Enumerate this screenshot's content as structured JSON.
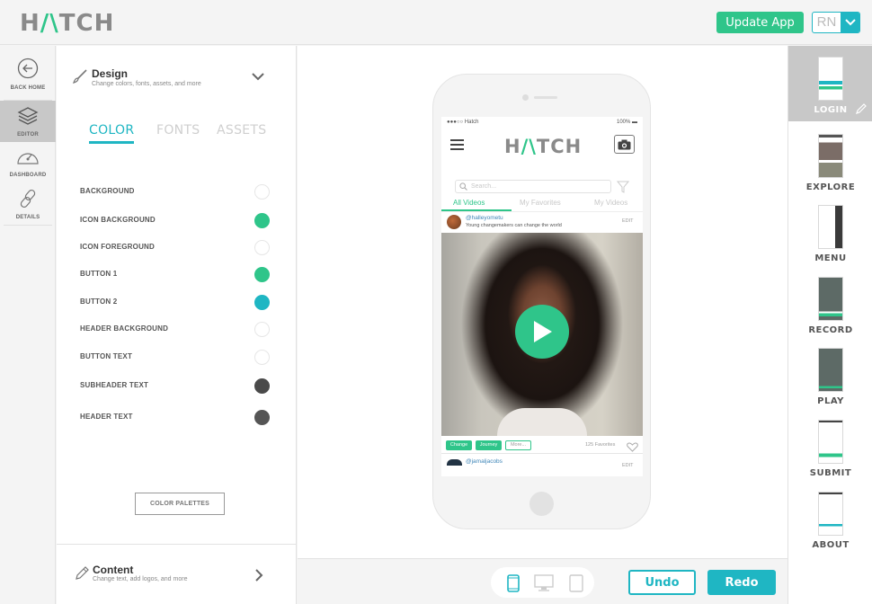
{
  "header": {
    "logo": {
      "left": "H",
      "accent": "/\\",
      "right": "TCH"
    },
    "update_button": "Update App",
    "user_initials": "RN"
  },
  "rail": {
    "items": [
      {
        "label": "BACK HOME",
        "icon": "back-arrow-icon",
        "active": false
      },
      {
        "label": "EDITOR",
        "icon": "layers-icon",
        "active": true
      },
      {
        "label": "DASHBOARD",
        "icon": "gauge-icon",
        "active": false
      },
      {
        "label": "DETAILS",
        "icon": "link-icon",
        "active": false
      }
    ]
  },
  "design_panel": {
    "title": "Design",
    "subtitle": "Change colors, fonts, assets, and more",
    "tabs": [
      {
        "label": "COLOR",
        "active": true
      },
      {
        "label": "FONTS",
        "active": false
      },
      {
        "label": "ASSETS",
        "active": false
      }
    ],
    "colors": [
      {
        "name": "BACKGROUND",
        "value": "#ffffff"
      },
      {
        "name": "ICON BACKGROUND",
        "value": "#2fc58a"
      },
      {
        "name": "ICON FOREGROUND",
        "value": "#ffffff"
      },
      {
        "name": "BUTTON 1",
        "value": "#2fc58a"
      },
      {
        "name": "BUTTON 2",
        "value": "#1fb6c3"
      },
      {
        "name": "HEADER BACKGROUND",
        "value": "#ffffff"
      },
      {
        "name": "BUTTON TEXT",
        "value": "#ffffff"
      },
      {
        "name": "SUBHEADER TEXT",
        "value": "#4a4a4a"
      },
      {
        "name": "HEADER TEXT",
        "value": "#555555"
      }
    ],
    "palette_button": "COLOR PALETTES"
  },
  "content_panel": {
    "title": "Content",
    "subtitle": "Change text, add logos, and more"
  },
  "phone": {
    "status_carrier": "●●●○○ Hatch",
    "status_battery": "100% ▬",
    "app_logo": {
      "left": "H",
      "accent": "/\\",
      "right": "TCH"
    },
    "search_placeholder": "Search...",
    "tabs": [
      {
        "label": "All Videos",
        "active": true
      },
      {
        "label": "My Favorites",
        "active": false
      },
      {
        "label": "My Videos",
        "active": false
      }
    ],
    "post": {
      "user": "@halleyometu",
      "caption": "Young changemakers can change the world",
      "edit": "EDIT",
      "tags": [
        "Change",
        "Journey",
        "More..."
      ],
      "favorites": "125 Favorites"
    },
    "post2": {
      "user": "@jamaljacobs",
      "edit": "EDIT"
    }
  },
  "bottom_bar": {
    "devices": [
      {
        "name": "phone",
        "active": true
      },
      {
        "name": "desktop",
        "active": false
      },
      {
        "name": "tablet",
        "active": false
      }
    ],
    "undo": "Undo",
    "redo": "Redo"
  },
  "pages": [
    {
      "label": "LOGIN",
      "active": true
    },
    {
      "label": "EXPLORE",
      "active": false
    },
    {
      "label": "MENU",
      "active": false
    },
    {
      "label": "RECORD",
      "active": false
    },
    {
      "label": "PLAY",
      "active": false
    },
    {
      "label": "SUBMIT",
      "active": false
    },
    {
      "label": "ABOUT",
      "active": false
    }
  ],
  "colors": {
    "green": "#2fc58a",
    "teal": "#1fb6c3",
    "gray_bg": "#f4f4f4"
  }
}
